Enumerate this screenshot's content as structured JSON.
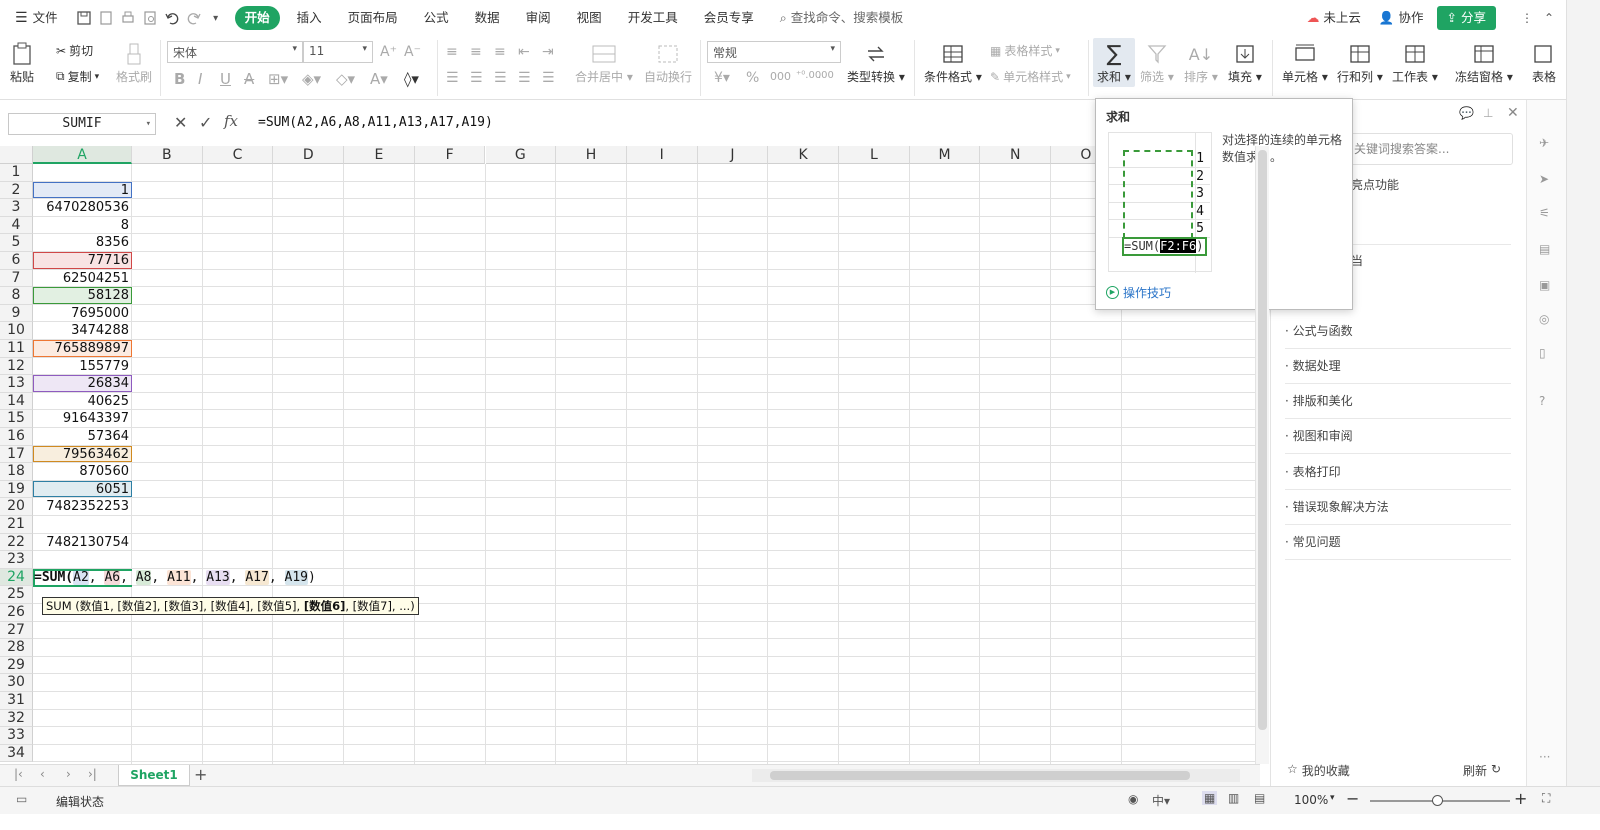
{
  "menu": {
    "file": "文件",
    "tabs": [
      "开始",
      "插入",
      "页面布局",
      "公式",
      "数据",
      "审阅",
      "视图",
      "开发工具",
      "会员专享"
    ],
    "search": "查找命令、搜索模板",
    "cloud": "未上云",
    "collab": "协作",
    "share": "分享"
  },
  "ribbon": {
    "paste": "粘贴",
    "cut": "剪切",
    "copy": "复制",
    "format_painter": "格式刷",
    "font_name": "宋体",
    "font_size": "11",
    "merge": "合并居中",
    "wrap": "自动换行",
    "number_format": "常规",
    "type_convert": "类型转换",
    "cond_format": "条件格式",
    "table_style": "表格样式",
    "cell_style": "单元格样式",
    "sum": "求和",
    "filter": "筛选",
    "sort": "排序",
    "fill": "填充",
    "cell": "单元格",
    "row_col": "行和列",
    "worksheet": "工作表",
    "freeze": "冻结窗格",
    "table_tool": "表格"
  },
  "formula_bar": {
    "name_box": "SUMIF",
    "fx": "fx",
    "formula": "=SUM(A2,A6,A8,A11,A13,A17,A19)"
  },
  "grid": {
    "columns": [
      "A",
      "B",
      "C",
      "D",
      "E",
      "F",
      "G",
      "H",
      "I",
      "J",
      "K",
      "L",
      "M",
      "N",
      "O"
    ],
    "rows": [
      "1",
      "2",
      "3",
      "4",
      "5",
      "6",
      "7",
      "8",
      "9",
      "10",
      "11",
      "12",
      "13",
      "14",
      "15",
      "16",
      "17",
      "18",
      "19",
      "20",
      "21",
      "22",
      "23",
      "24",
      "25",
      "26",
      "27",
      "28",
      "29",
      "30",
      "31",
      "32",
      "33",
      "34"
    ],
    "col_a_values": [
      "",
      "1",
      "6470280536",
      "8",
      "8356",
      "77716",
      "62504251",
      "58128",
      "7695000",
      "3474288",
      "765889897",
      "155779",
      "26834",
      "40625",
      "91643397",
      "57364",
      "79563462",
      "870560",
      "6051",
      "7482352253",
      "",
      "7482130754",
      ""
    ],
    "edit_prefix": "=SUM(",
    "edit_refs": [
      "A2",
      "A6",
      "A8",
      "A11",
      "A13",
      "A17",
      "A19"
    ],
    "edit_suffix": ")",
    "arg_hint_pre": "SUM (数值1, [数值2], [数值3], [数值4], [数值5], ",
    "arg_hint_bold": "[数值6]",
    "arg_hint_post": ", [数值7], ...)",
    "ref_colors": [
      "#4472c4",
      "#d04848",
      "#3a9a3a",
      "#ee7733",
      "#8e5bbf",
      "#d08a20",
      "#2e7fa4"
    ]
  },
  "tooltip": {
    "title": "求和",
    "values": [
      "1",
      "2",
      "3",
      "4",
      "5"
    ],
    "formula_pre": "=SUM(",
    "formula_range": "F2:F6",
    "formula_post": ")",
    "description": "对选择的连续的单元格数值求和。",
    "tips_link": "操作技巧"
  },
  "right_panel": {
    "search_placeholder": "关键词搜索答案...",
    "partial_item1": "亮点功能",
    "partial_item2": "当",
    "items": [
      "公式与函数",
      "数据处理",
      "排版和美化",
      "视图和审阅",
      "表格打印",
      "错误现象解决方法",
      "常见问题"
    ],
    "favorites": "我的收藏",
    "refresh": "刷新"
  },
  "sheet_tabs": {
    "active": "Sheet1"
  },
  "status": {
    "mode": "编辑状态",
    "zoom": "100%"
  }
}
